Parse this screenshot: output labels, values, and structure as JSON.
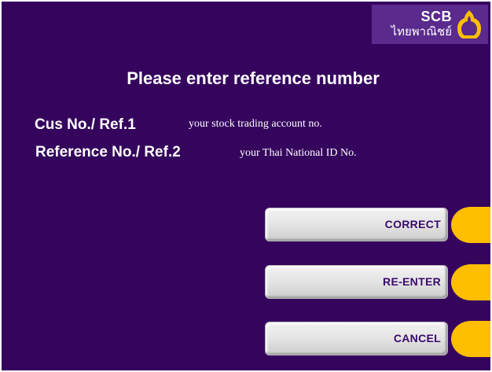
{
  "brand": {
    "name_en": "SCB",
    "name_th": "ไทยพาณิชย์",
    "logo_icon": "scb-bank-emblem-icon",
    "colors": {
      "background": "#35055e",
      "accent": "#ffbe00",
      "button_text": "#3a0a6c"
    }
  },
  "screen": {
    "title": "Please enter reference number",
    "fields": [
      {
        "label": "Cus No./ Ref.1",
        "description": "your stock trading account no."
      },
      {
        "label": "Reference No./ Ref.2",
        "description": "your Thai National ID No."
      }
    ]
  },
  "buttons": {
    "correct": "CORRECT",
    "reenter": "RE-ENTER",
    "cancel": "CANCEL"
  }
}
